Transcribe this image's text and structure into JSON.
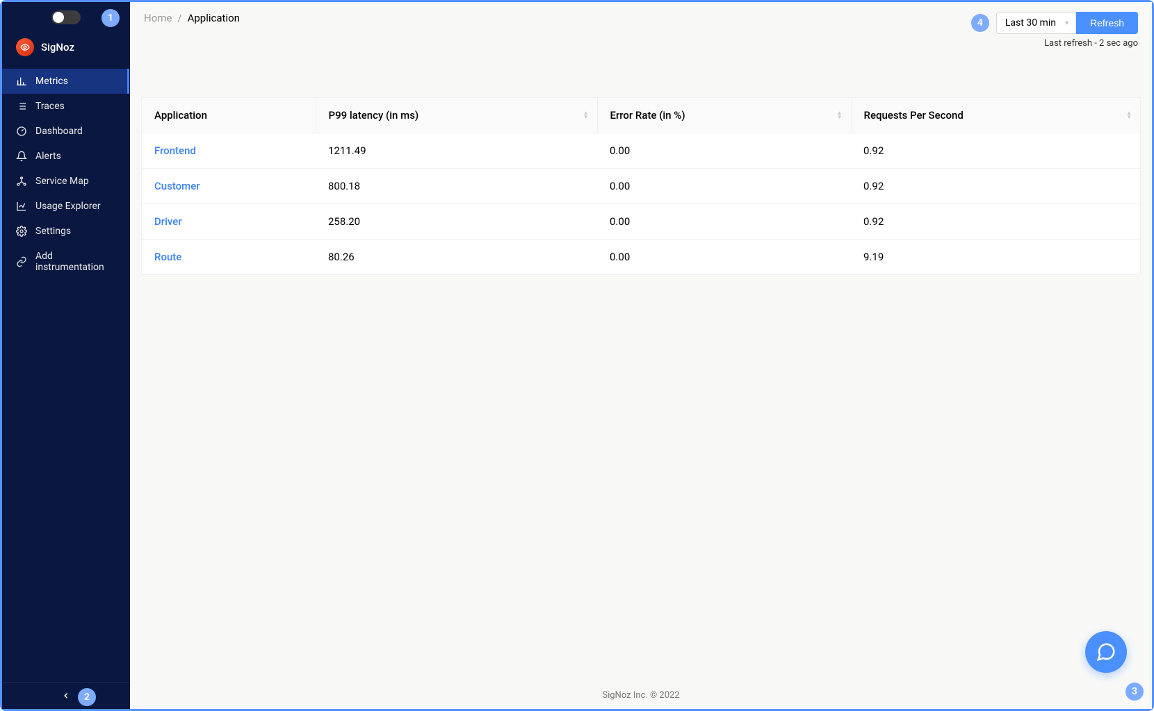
{
  "annotations": {
    "one": "1",
    "two": "2",
    "three": "3",
    "four": "4"
  },
  "brand": {
    "name": "SigNoz"
  },
  "sidebar": {
    "items": [
      {
        "label": "Metrics"
      },
      {
        "label": "Traces"
      },
      {
        "label": "Dashboard"
      },
      {
        "label": "Alerts"
      },
      {
        "label": "Service Map"
      },
      {
        "label": "Usage Explorer"
      },
      {
        "label": "Settings"
      },
      {
        "label": "Add instrumentation"
      }
    ]
  },
  "breadcrumb": {
    "home": "Home",
    "sep": "/",
    "current": "Application"
  },
  "topbar": {
    "time_range": "Last 30 min",
    "refresh_label": "Refresh",
    "last_refresh": "Last refresh - 2 sec ago"
  },
  "table": {
    "headers": {
      "app": "Application",
      "p99": "P99 latency (in ms)",
      "err": "Error Rate (in %)",
      "rps": "Requests Per Second"
    },
    "rows": [
      {
        "app": "Frontend",
        "p99": "1211.49",
        "err": "0.00",
        "rps": "0.92"
      },
      {
        "app": "Customer",
        "p99": "800.18",
        "err": "0.00",
        "rps": "0.92"
      },
      {
        "app": "Driver",
        "p99": "258.20",
        "err": "0.00",
        "rps": "0.92"
      },
      {
        "app": "Route",
        "p99": "80.26",
        "err": "0.00",
        "rps": "9.19"
      }
    ]
  },
  "footer": {
    "text": "SigNoz Inc. © 2022"
  }
}
